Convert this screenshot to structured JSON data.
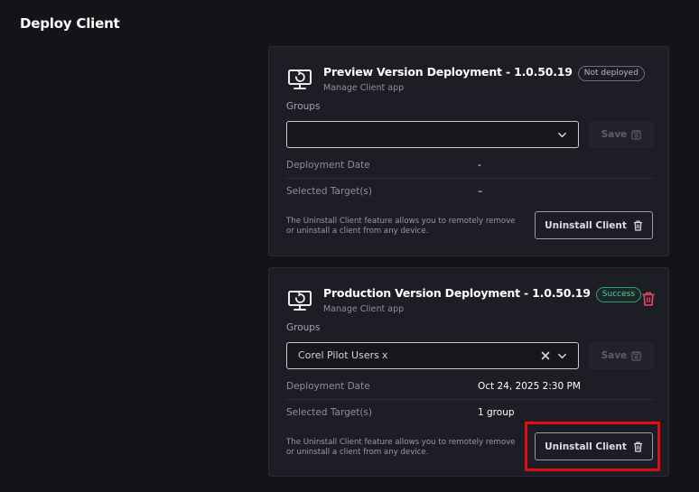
{
  "page": {
    "title": "Deploy Client"
  },
  "deployments": [
    {
      "title": "Preview Version Deployment - 1.0.50.19",
      "status": "Not deployed",
      "subtitle": "Manage Client app",
      "groups_label": "Groups",
      "selected_groups": [],
      "save_label": "Save",
      "fields": [
        {
          "label": "Deployment Date",
          "value": "-"
        },
        {
          "label": "Selected Target(s)",
          "value": "–"
        }
      ],
      "note": "The Uninstall Client feature allows you to remotely remove or uninstall a client from any device.",
      "uninstall_label": "Uninstall Client"
    },
    {
      "title": "Production Version Deployment - 1.0.50.19",
      "status": "Success",
      "subtitle": "Manage Client app",
      "groups_label": "Groups",
      "selected_groups": [
        {
          "name": "Corel Pilot Users",
          "remove": "x"
        }
      ],
      "save_label": "Save",
      "fields": [
        {
          "label": "Deployment Date",
          "value": "Oct 24, 2025 2:30 PM"
        },
        {
          "label": "Selected Target(s)",
          "value": "1 group"
        }
      ],
      "note": "The Uninstall Client feature allows you to remotely remove or uninstall a client from any device.",
      "uninstall_label": "Uninstall Client"
    }
  ],
  "icons": {
    "app": "monitor-refresh-icon",
    "save": "floppy-disk-icon",
    "uninstall": "trash-icon",
    "delete": "trash-icon",
    "dropdown": "chevron-down-icon",
    "clear": "close-icon"
  },
  "colors": {
    "background": "#131318",
    "card": "#1d1d26",
    "success": "#46d68c",
    "danger": "#e0465a",
    "highlight": "#e00d12"
  }
}
